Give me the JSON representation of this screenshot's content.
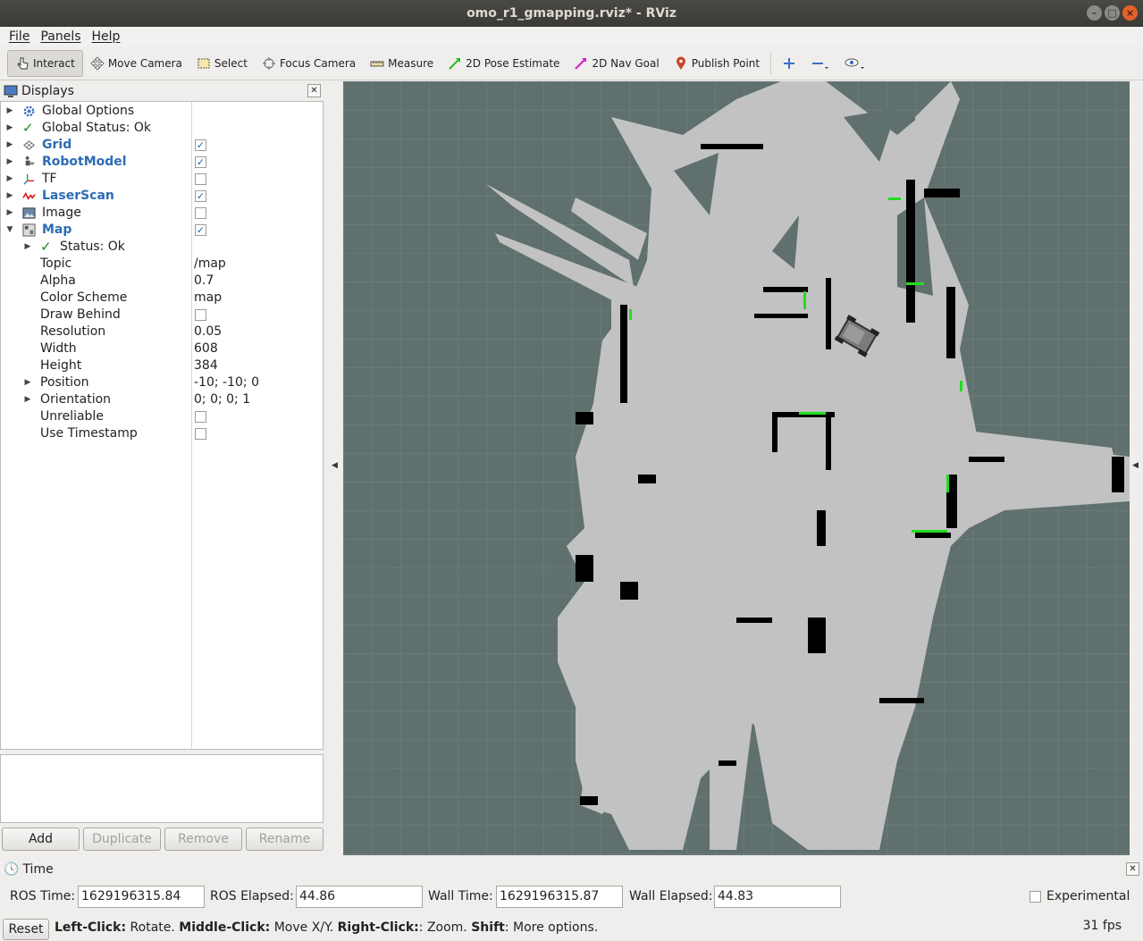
{
  "window": {
    "title": "omo_r1_gmapping.rviz* - RViz"
  },
  "menu": [
    "File",
    "Panels",
    "Help"
  ],
  "toolbar": {
    "tools": [
      {
        "label": "Interact",
        "icon": "hand-pointer-icon",
        "active": true
      },
      {
        "label": "Move Camera",
        "icon": "move-arrows-icon",
        "active": false
      },
      {
        "label": "Select",
        "icon": "selection-box-icon",
        "active": false
      },
      {
        "label": "Focus Camera",
        "icon": "target-icon",
        "active": false
      },
      {
        "label": "Measure",
        "icon": "ruler-icon",
        "active": false
      },
      {
        "label": "2D Pose Estimate",
        "icon": "green-arrow-icon",
        "active": false
      },
      {
        "label": "2D Nav Goal",
        "icon": "magenta-arrow-icon",
        "active": false
      },
      {
        "label": "Publish Point",
        "icon": "map-pin-icon",
        "active": false
      }
    ]
  },
  "displays": {
    "title": "Displays",
    "items": [
      {
        "label": "Global Options",
        "icon": "gear-icon",
        "blue": false
      },
      {
        "label": "Global Status: Ok",
        "icon": "check-icon",
        "blue": false
      },
      {
        "label": "Grid",
        "icon": "grid-icon",
        "blue": true,
        "checked": true
      },
      {
        "label": "RobotModel",
        "icon": "robot-icon",
        "blue": true,
        "checked": true
      },
      {
        "label": "TF",
        "icon": "axes-icon",
        "blue": false,
        "checked": false
      },
      {
        "label": "LaserScan",
        "icon": "laser-icon",
        "blue": true,
        "checked": true
      },
      {
        "label": "Image",
        "icon": "image-icon",
        "blue": false,
        "checked": false
      },
      {
        "label": "Map",
        "icon": "map-icon",
        "blue": true,
        "checked": true
      }
    ],
    "map_props": {
      "status": "Status: Ok",
      "topic_label": "Topic",
      "topic": "/map",
      "alpha_label": "Alpha",
      "alpha": "0.7",
      "scheme_label": "Color Scheme",
      "scheme": "map",
      "draw_behind_label": "Draw Behind",
      "draw_behind": false,
      "resolution_label": "Resolution",
      "resolution": "0.05",
      "width_label": "Width",
      "width": "608",
      "height_label": "Height",
      "height": "384",
      "position_label": "Position",
      "position": "-10; -10; 0",
      "orientation_label": "Orientation",
      "orientation": "0; 0; 0; 1",
      "unreliable_label": "Unreliable",
      "unreliable": false,
      "timestamp_label": "Use Timestamp",
      "timestamp": false
    },
    "buttons": {
      "add": "Add",
      "duplicate": "Duplicate",
      "remove": "Remove",
      "rename": "Rename"
    }
  },
  "time": {
    "title": "Time",
    "ros_time_label": "ROS Time:",
    "ros_time": "1629196315.84",
    "ros_elapsed_label": "ROS Elapsed:",
    "ros_elapsed": "44.86",
    "wall_time_label": "Wall Time:",
    "wall_time": "1629196315.87",
    "wall_elapsed_label": "Wall Elapsed:",
    "wall_elapsed": "44.83",
    "experimental_label": "Experimental"
  },
  "status": {
    "reset": "Reset",
    "h1": "Left-Click:",
    "t1": " Rotate. ",
    "h2": "Middle-Click:",
    "t2": " Move X/Y. ",
    "h3": "Right-Click:",
    "t3": ": Zoom. ",
    "h4": "Shift",
    "t4": ": More options.",
    "fps": "31 fps"
  },
  "colors": {
    "unknown": "#5f706e",
    "free": "#c2c2c2",
    "occupied": "#000000",
    "laser": "#22dd22"
  }
}
